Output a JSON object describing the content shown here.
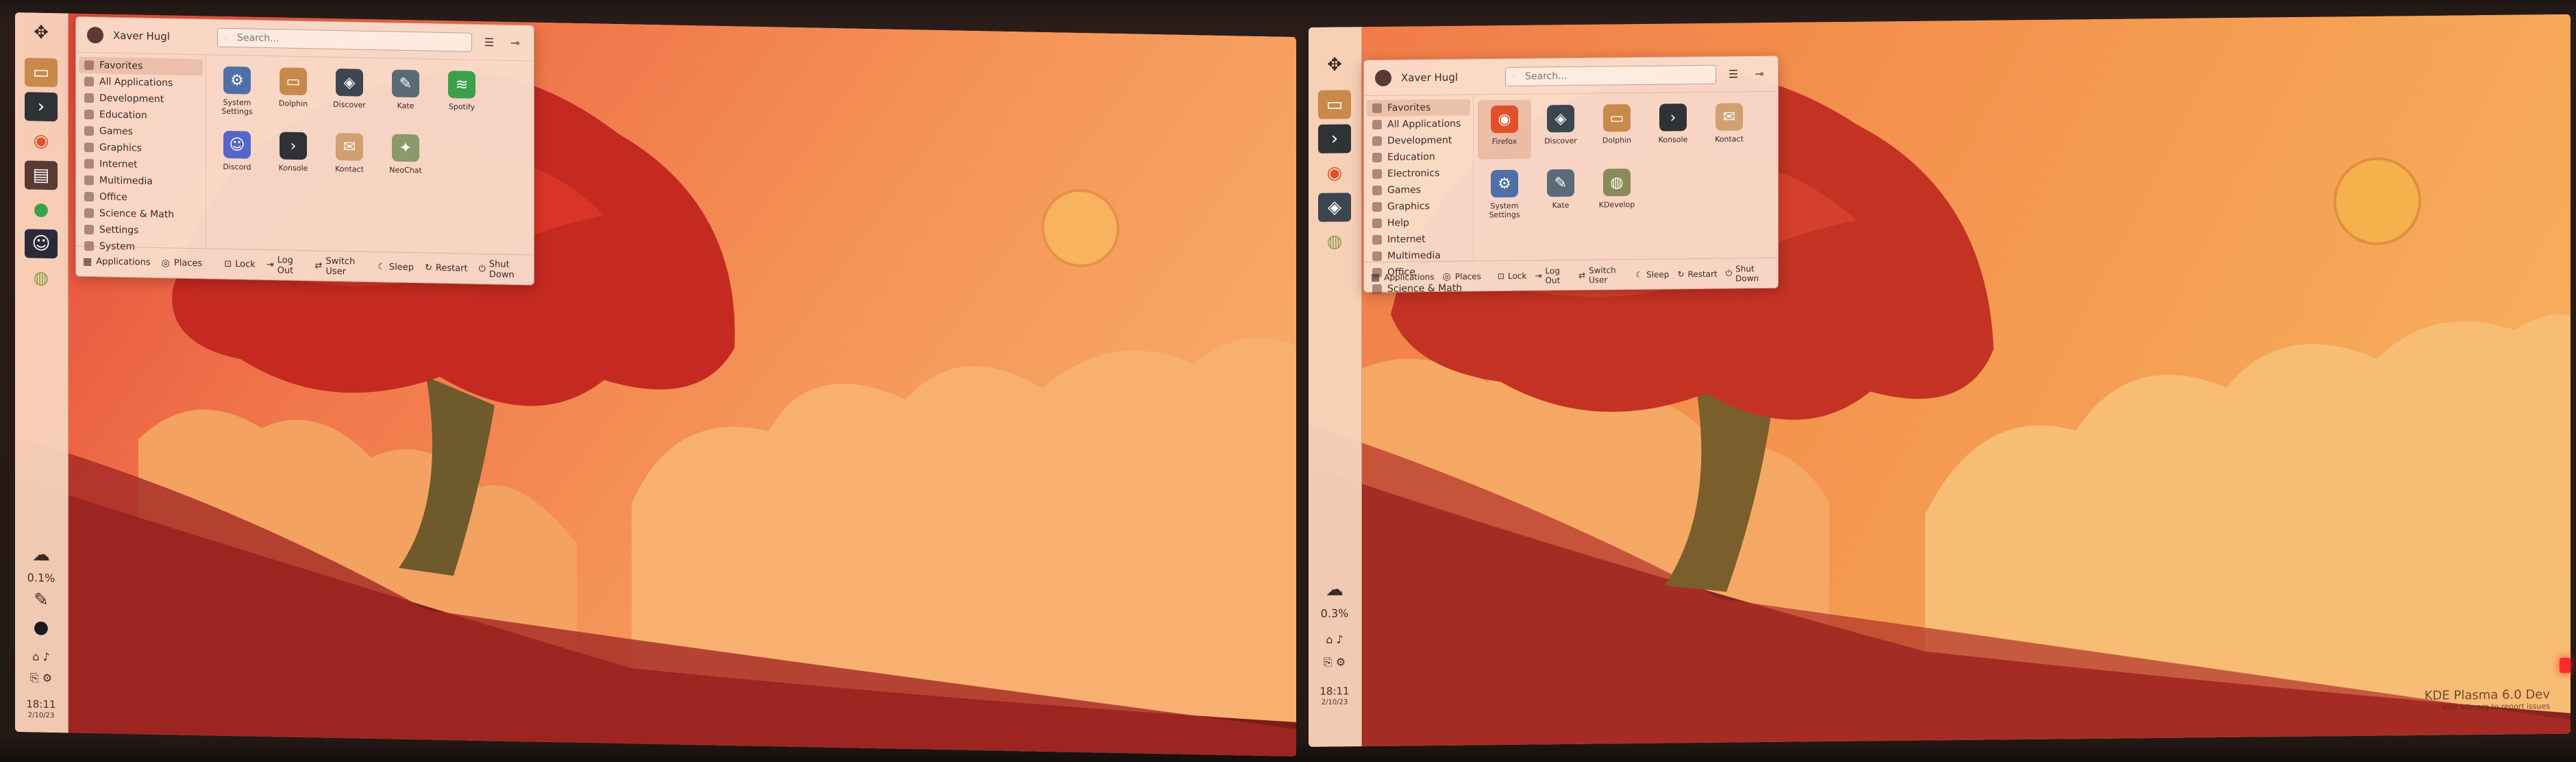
{
  "user_name": "Xaver Hugl",
  "search_placeholder": "Search...",
  "screen1": {
    "categories": [
      "Favorites",
      "All Applications",
      "Development",
      "Education",
      "Games",
      "Graphics",
      "Internet",
      "Multimedia",
      "Office",
      "Science & Math",
      "Settings",
      "System"
    ],
    "selected_category": 0,
    "apps": [
      {
        "label": "System Settings",
        "icon": "settings-icon",
        "color": "#4f6fa8",
        "glyph": "⚙"
      },
      {
        "label": "Dolphin",
        "icon": "folder-icon",
        "color": "#c88a4a",
        "glyph": "▭"
      },
      {
        "label": "Discover",
        "icon": "discover-icon",
        "color": "#3c4650",
        "glyph": "◈"
      },
      {
        "label": "Kate",
        "icon": "kate-icon",
        "color": "#5a6a78",
        "glyph": "✎"
      },
      {
        "label": "Spotify",
        "icon": "spotify-icon",
        "color": "#3aa04a",
        "glyph": "≋"
      },
      {
        "label": "Discord",
        "icon": "discord-icon",
        "color": "#5565c8",
        "glyph": "☺"
      },
      {
        "label": "Konsole",
        "icon": "terminal-icon",
        "color": "#2f3236",
        "glyph": "›"
      },
      {
        "label": "Kontact",
        "icon": "kontact-icon",
        "color": "#d0a070",
        "glyph": "✉"
      },
      {
        "label": "NeoChat",
        "icon": "chat-icon",
        "color": "#8a9a6a",
        "glyph": "✦"
      }
    ],
    "footer": {
      "tab_apps": "Applications",
      "tab_places": "Places",
      "lock": "Lock",
      "logout": "Log Out",
      "switch": "Switch User",
      "sleep": "Sleep",
      "restart": "Restart",
      "shutdown": "Shut Down"
    },
    "tray": {
      "percent": "0.1%",
      "time": "18:11",
      "date": "2/10/23"
    }
  },
  "screen2": {
    "categories": [
      "Favorites",
      "All Applications",
      "Development",
      "Education",
      "Electronics",
      "Games",
      "Graphics",
      "Help",
      "Internet",
      "Multimedia",
      "Office",
      "Science & Math"
    ],
    "selected_category": 0,
    "apps": [
      {
        "label": "Firefox",
        "icon": "firefox-icon",
        "color": "#e0502a",
        "glyph": "◉"
      },
      {
        "label": "Discover",
        "icon": "discover-icon",
        "color": "#3c4650",
        "glyph": "◈"
      },
      {
        "label": "Dolphin",
        "icon": "folder-icon",
        "color": "#c88a4a",
        "glyph": "▭"
      },
      {
        "label": "Konsole",
        "icon": "terminal-icon",
        "color": "#2f3236",
        "glyph": "›"
      },
      {
        "label": "Kontact",
        "icon": "kontact-icon",
        "color": "#d0a070",
        "glyph": "✉"
      },
      {
        "label": "System Settings",
        "icon": "settings-icon",
        "color": "#4f6fa8",
        "glyph": "⚙"
      },
      {
        "label": "Kate",
        "icon": "kate-icon",
        "color": "#5a6a78",
        "glyph": "✎"
      },
      {
        "label": "KDevelop",
        "icon": "kdevelop-icon",
        "color": "#8a8a5a",
        "glyph": "◍"
      }
    ],
    "footer": {
      "tab_apps": "Applications",
      "tab_places": "Places",
      "lock": "Lock",
      "logout": "Log Out",
      "switch": "Switch User",
      "sleep": "Sleep",
      "restart": "Restart",
      "shutdown": "Shut Down"
    },
    "tray": {
      "percent": "0.3%",
      "time": "18:11",
      "date": "2/10/23"
    },
    "brand_line1": "KDE Plasma 6.0 Dev",
    "brand_line2": "Visit kde.org to report issues"
  },
  "colors": {
    "wallpaper_sky": "#f08a52",
    "tree": "#c42a20",
    "panel": "#f8d6be"
  }
}
